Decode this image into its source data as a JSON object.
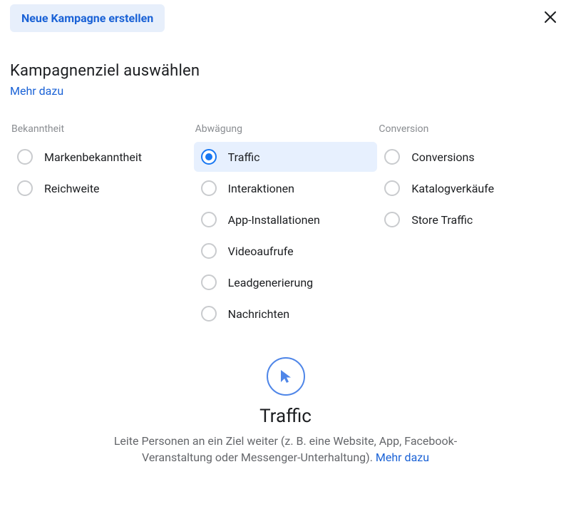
{
  "header": {
    "pill_label": "Neue Kampagne erstellen"
  },
  "title_section": {
    "title": "Kampagnenziel auswählen",
    "learn_more": "Mehr dazu"
  },
  "columns": {
    "awareness": {
      "header": "Bekanntheit",
      "options": [
        {
          "label": "Markenbekanntheit",
          "selected": false
        },
        {
          "label": "Reichweite",
          "selected": false
        }
      ]
    },
    "consideration": {
      "header": "Abwägung",
      "options": [
        {
          "label": "Traffic",
          "selected": true
        },
        {
          "label": "Interaktionen",
          "selected": false
        },
        {
          "label": "App-Installationen",
          "selected": false
        },
        {
          "label": "Videoaufrufe",
          "selected": false
        },
        {
          "label": "Leadgenerierung",
          "selected": false
        },
        {
          "label": "Nachrichten",
          "selected": false
        }
      ]
    },
    "conversion": {
      "header": "Conversion",
      "options": [
        {
          "label": "Conversions",
          "selected": false
        },
        {
          "label": "Katalogverkäufe",
          "selected": false
        },
        {
          "label": "Store Traffic",
          "selected": false
        }
      ]
    }
  },
  "details": {
    "title": "Traffic",
    "description_pre": "Leite Personen an ein Ziel weiter (z. B. eine Website, App, Facebook-Veranstaltung oder Messenger-Unterhaltung). ",
    "learn_more": "Mehr dazu"
  }
}
